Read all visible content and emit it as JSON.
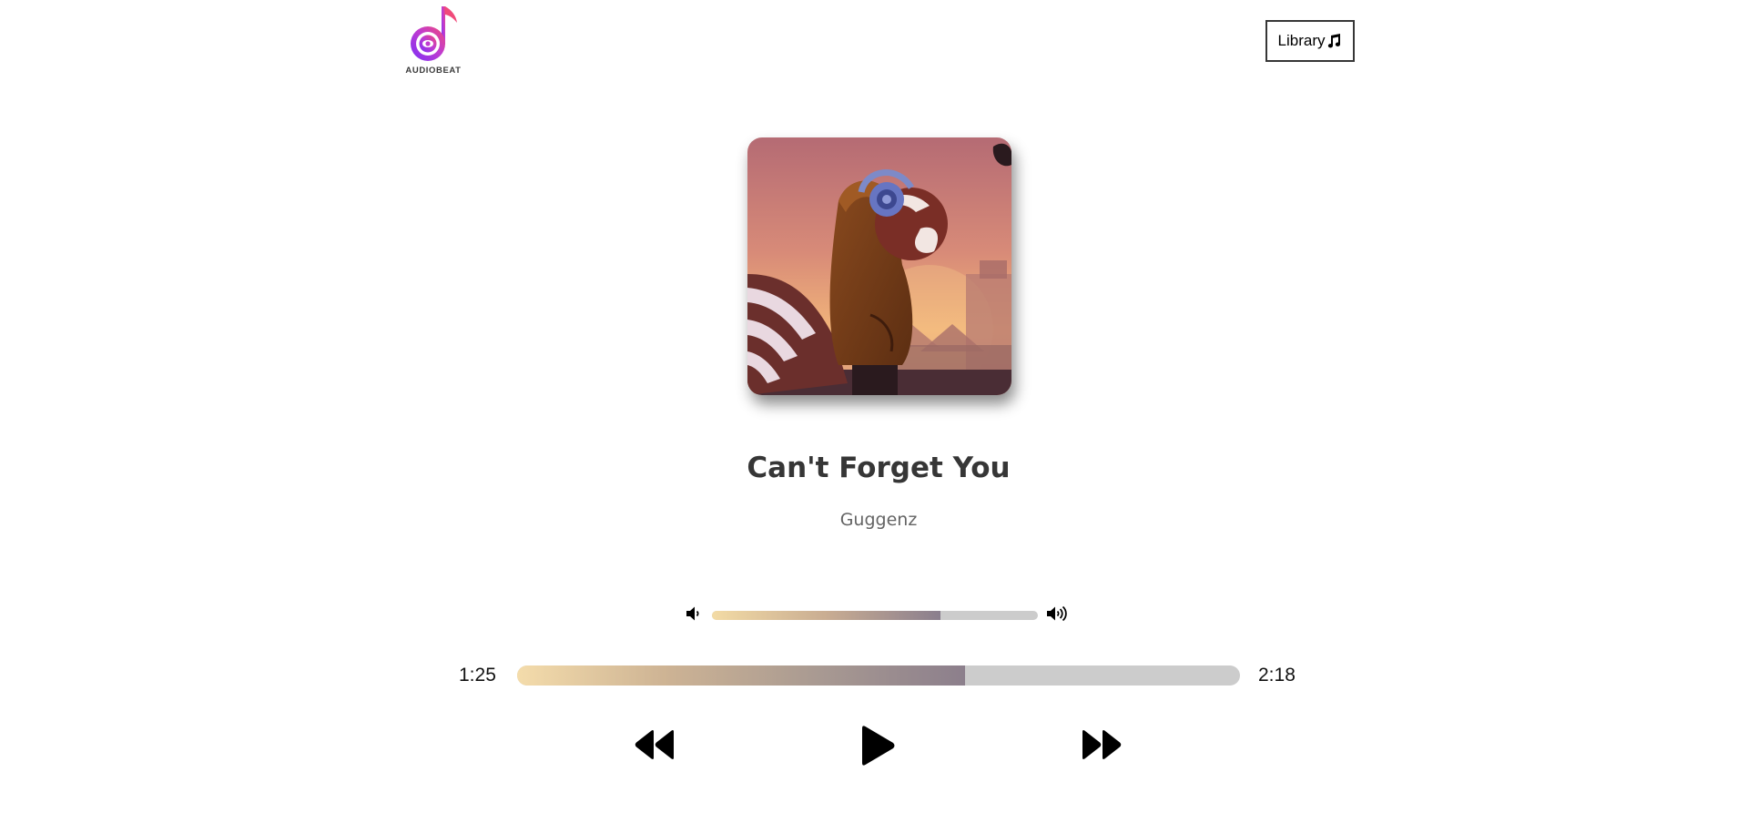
{
  "header": {
    "logo_text": "AUDIOBEAT",
    "library_label": "Library"
  },
  "song": {
    "title": "Can't Forget You",
    "artist": "Guggenz"
  },
  "volume": {
    "level": 0.7
  },
  "playback": {
    "current_time": "1:25",
    "duration": "2:18",
    "progress": 0.62
  },
  "icons": {
    "logo": "music-note-logo-icon",
    "library": "music-note-icon",
    "volume_low": "volume-low-icon",
    "volume_high": "volume-high-icon",
    "previous": "rewind-icon",
    "play": "play-icon",
    "next": "fast-forward-icon"
  },
  "colors": {
    "text": "#363636",
    "track": "#cccccc",
    "gradient_start": "#f3dba5",
    "gradient_end": "#8a7e8e",
    "logo_pink": "#e0457b",
    "logo_purple": "#7b2ff7"
  }
}
